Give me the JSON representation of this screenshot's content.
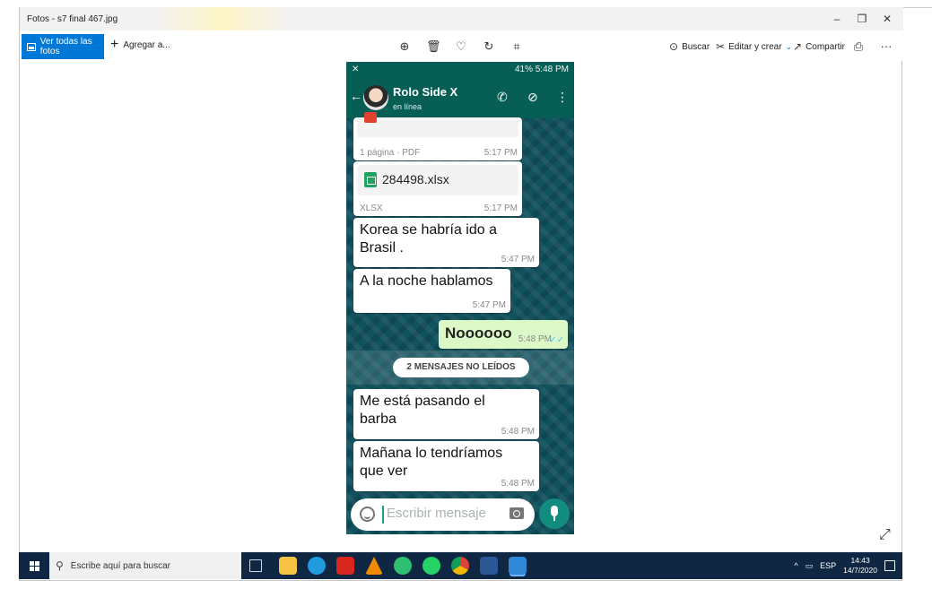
{
  "window": {
    "title": "Fotos - s7 final 467.jpg",
    "minimize": "–",
    "restore": "❐",
    "close": "✕"
  },
  "toolbar": {
    "see_all_label": "Ver todas las fotos",
    "add_label": "Agregar a...",
    "search_label": "Buscar",
    "edit_label": "Editar y crear",
    "share_label": "Compartir",
    "more": "···",
    "icons": [
      "zoom-in-icon",
      "delete-icon",
      "heart-icon",
      "rotate-icon",
      "crop-icon",
      "print-icon"
    ]
  },
  "phone": {
    "status_left": "✕",
    "status_right": "41% 5:48 PM",
    "contact_name": "Rolo Side X",
    "contact_status": "en línea",
    "messages": [
      {
        "meta": "1 página · PDF",
        "time": "5:17 PM",
        "text": "",
        "outgoing": false
      },
      {
        "file": "284498.xlsx",
        "meta": "XLSX",
        "time": "5:17 PM",
        "outgoing": false
      },
      {
        "text": "Korea se habría ido a Brasil .",
        "time": "5:47 PM",
        "outgoing": false
      },
      {
        "text": "A la noche hablamos",
        "time": "5:47 PM",
        "outgoing": false
      },
      {
        "text": "Noooooo",
        "time": "5:48 PM",
        "outgoing": true
      },
      {
        "text": "Me está pasando el barba",
        "time": "5:48 PM",
        "outgoing": false
      },
      {
        "text": "Mañana lo tendríamos que ver",
        "time": "5:48 PM",
        "outgoing": false
      }
    ],
    "unread_label": "2 MENSAJES NO LEÍDOS",
    "composer_placeholder": "Escribir mensaje"
  },
  "taskbar": {
    "search_placeholder": "Escribe aquí para buscar",
    "language": "ESP",
    "time": "14:43",
    "date": "14/7/2020",
    "colors": {
      "bg": "#0f2743",
      "accent": "#0078d7"
    }
  }
}
